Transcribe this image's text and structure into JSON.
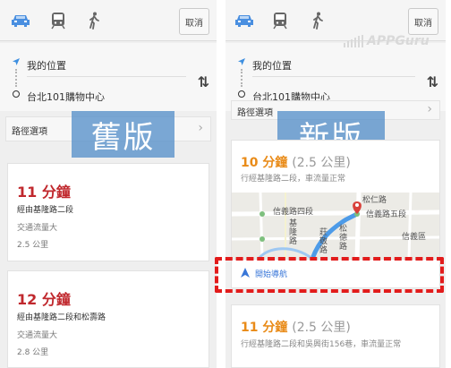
{
  "left": {
    "cancel_label": "取消",
    "modes": [
      "car-icon",
      "transit-icon",
      "walk-icon"
    ],
    "origin": "我的位置",
    "destination": "台北101購物中心",
    "options_label": "路徑選項",
    "version_label": "舊版",
    "routes": [
      {
        "time": "11 分鐘",
        "road": "經由基隆路二段",
        "traffic": "交通流量大",
        "distance": "2.5 公里"
      },
      {
        "time": "12 分鐘",
        "road": "經由基隆路二段和松壽路",
        "traffic": "交通流量大",
        "distance": "2.8 公里"
      }
    ]
  },
  "right": {
    "cancel_label": "取消",
    "origin": "我的位置",
    "destination": "台北101購物中心",
    "options_label": "路徑選項",
    "version_label": "新版",
    "routes": [
      {
        "time": "10 分鐘",
        "distance": "(2.5 公里)",
        "sub": "行經基隆路二段，車流量正常"
      },
      {
        "time": "11 分鐘",
        "distance": "(2.5 公里)",
        "sub": "行經基隆路二段和吳興街156巷，車流量正常"
      }
    ],
    "start_nav_label": "開始導航",
    "map_labels": {
      "road1": "信義路四段",
      "road2": "信義路五段",
      "district": "信義區",
      "road3": "松仁路",
      "road4": "基隆路",
      "road5": "莊敬路",
      "road6": "松德路"
    }
  },
  "watermark": "APPGuru",
  "colors": {
    "time_red": "#c0282d",
    "time_orange": "#e98b18",
    "accent_blue": "#3876d8",
    "highlight_red": "#e21c1c",
    "label_bg": "#508cc8"
  }
}
